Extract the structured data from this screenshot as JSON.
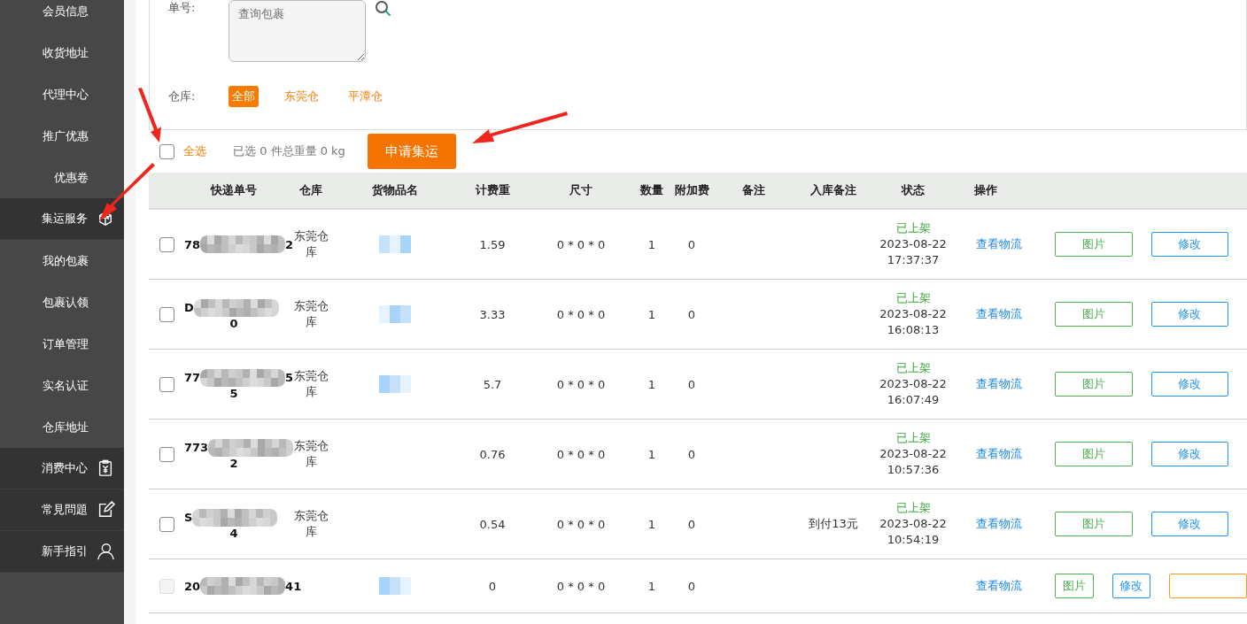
{
  "sidebar": {
    "items": [
      {
        "label": "会员信息",
        "kind": "plain"
      },
      {
        "label": "收货地址",
        "kind": "plain"
      },
      {
        "label": "代理中心",
        "kind": "plain"
      },
      {
        "label": "推广优惠",
        "kind": "plain"
      },
      {
        "label": "优惠卷",
        "kind": "plain"
      },
      {
        "label": "集运服务",
        "kind": "group",
        "expanded": true,
        "children": [
          {
            "label": "我的包裹"
          },
          {
            "label": "包裹认领"
          },
          {
            "label": "订单管理"
          },
          {
            "label": "实名认证"
          },
          {
            "label": "仓库地址"
          }
        ]
      },
      {
        "label": "消费中心",
        "kind": "group"
      },
      {
        "label": "常見問題",
        "kind": "group"
      },
      {
        "label": "新手指引",
        "kind": "group"
      }
    ]
  },
  "search": {
    "label": "单号:",
    "placeholder": "查询包裹"
  },
  "warehouse_filter": {
    "label": "仓库:",
    "options": [
      {
        "label": "全部",
        "selected": true
      },
      {
        "label": "东莞仓",
        "selected": false
      },
      {
        "label": "平潭仓",
        "selected": false
      }
    ]
  },
  "toolbar": {
    "select_all": {
      "label": "全选",
      "checked": false
    },
    "summary": "已选 0 件总重量 0 kg",
    "apply_button": "申请集运"
  },
  "table": {
    "columns": [
      "快递单号",
      "仓库",
      "货物品名",
      "计费重",
      "尺寸",
      "数量",
      "附加费",
      "备注",
      "入库备注",
      "状态",
      "操作"
    ],
    "rows": [
      {
        "checked": false,
        "disabled": false,
        "tracking_start": "78",
        "tracking_end": "2",
        "tracking_line2": "",
        "warehouse": "东莞仓库",
        "goods_blurred": true,
        "weight": "1.59",
        "size": "0 * 0 * 0",
        "quantity": "1",
        "fee": "0",
        "stock_note": "",
        "status": "已上架",
        "time": "2023-08-22 17:37:37",
        "link": "查看物流",
        "photo_button": "图片",
        "edit_button": "修改",
        "extra_button": false
      },
      {
        "checked": false,
        "disabled": false,
        "tracking_start": "D",
        "tracking_end": "",
        "tracking_line2": "0",
        "warehouse": "东莞仓库",
        "goods_blurred": true,
        "weight": "3.33",
        "size": "0 * 0 * 0",
        "quantity": "1",
        "fee": "0",
        "stock_note": "",
        "status": "已上架",
        "time": "2023-08-22 16:08:13",
        "link": "查看物流",
        "photo_button": "图片",
        "edit_button": "修改",
        "extra_button": false
      },
      {
        "checked": false,
        "disabled": false,
        "tracking_start": "77",
        "tracking_end": "5",
        "tracking_line2": "5",
        "warehouse": "东莞仓库",
        "goods_blurred": true,
        "weight": "5.7",
        "size": "0 * 0 * 0",
        "quantity": "1",
        "fee": "0",
        "stock_note": "",
        "status": "已上架",
        "time": "2023-08-22 16:07:49",
        "link": "查看物流",
        "photo_button": "图片",
        "edit_button": "修改",
        "extra_button": false
      },
      {
        "checked": false,
        "disabled": false,
        "tracking_start": "773",
        "tracking_end": "",
        "tracking_line2": "2",
        "warehouse": "东莞仓库",
        "goods_blurred": false,
        "weight": "0.76",
        "size": "0 * 0 * 0",
        "quantity": "1",
        "fee": "0",
        "stock_note": "",
        "status": "已上架",
        "time": "2023-08-22 10:57:36",
        "link": "查看物流",
        "photo_button": "图片",
        "edit_button": "修改",
        "extra_button": false
      },
      {
        "checked": false,
        "disabled": false,
        "tracking_start": "S",
        "tracking_end": "",
        "tracking_line2": "4",
        "warehouse": "东莞仓库",
        "goods_blurred": false,
        "weight": "0.54",
        "size": "0 * 0 * 0",
        "quantity": "1",
        "fee": "0",
        "stock_note": "到付13元",
        "status": "已上架",
        "time": "2023-08-22 10:54:19",
        "link": "查看物流",
        "photo_button": "图片",
        "edit_button": "修改",
        "extra_button": false
      },
      {
        "checked": false,
        "disabled": true,
        "tracking_start": "20",
        "tracking_end": "41",
        "tracking_line2": "",
        "warehouse": "",
        "goods_blurred": true,
        "weight": "0",
        "size": "0 * 0 * 0",
        "quantity": "1",
        "fee": "0",
        "stock_note": "",
        "status": "",
        "time": "",
        "link": "查看物流",
        "photo_button": "图片",
        "edit_button": "修改",
        "extra_button": true
      }
    ]
  }
}
